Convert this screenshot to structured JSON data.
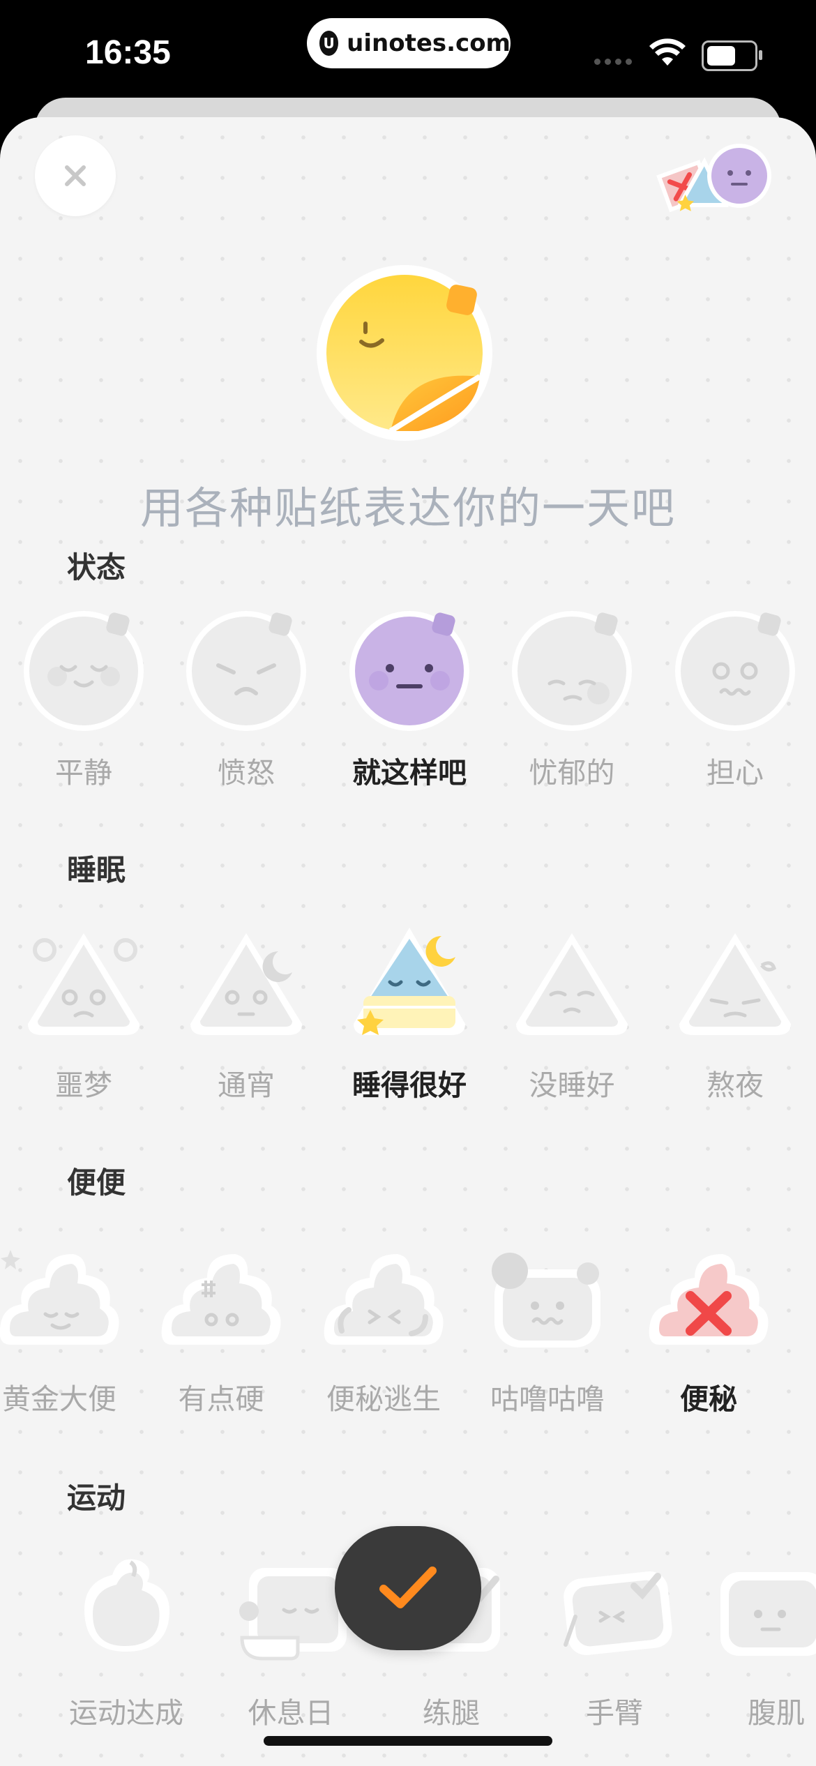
{
  "status_bar": {
    "time": "16:35",
    "url": "uinotes.com",
    "url_logo": "U"
  },
  "header": {
    "close_icon": "close-icon",
    "sticker_stack_icon": "sticker-stack-icon"
  },
  "hero_sticker": "smiley-sticker-icon",
  "subtitle": "用各种贴纸表达你的一天吧",
  "sections": [
    {
      "title": "状态",
      "items": [
        {
          "label": "平静",
          "selected": false
        },
        {
          "label": "愤怒",
          "selected": false
        },
        {
          "label": "就这样吧",
          "selected": true
        },
        {
          "label": "忧郁的",
          "selected": false
        },
        {
          "label": "担心",
          "selected": false
        }
      ]
    },
    {
      "title": "睡眠",
      "items": [
        {
          "label": "噩梦",
          "selected": false
        },
        {
          "label": "通宵",
          "selected": false
        },
        {
          "label": "睡得很好",
          "selected": true
        },
        {
          "label": "没睡好",
          "selected": false
        },
        {
          "label": "熬夜",
          "selected": false
        }
      ]
    },
    {
      "title": "便便",
      "items": [
        {
          "label": "黄金大便",
          "selected": false
        },
        {
          "label": "有点硬",
          "selected": false
        },
        {
          "label": "便秘逃生",
          "selected": false
        },
        {
          "label": "咕噜咕噜",
          "selected": false
        },
        {
          "label": "便秘",
          "selected": true
        }
      ]
    },
    {
      "title": "运动",
      "items": [
        {
          "label": "运动达成",
          "selected": false
        },
        {
          "label": "休息日",
          "selected": false
        },
        {
          "label": "练腿",
          "selected": false
        },
        {
          "label": "手臂",
          "selected": false
        },
        {
          "label": "腹肌",
          "selected": false
        }
      ]
    }
  ],
  "confirm_icon": "checkmark-icon",
  "colors": {
    "selected_mood": "#c9b3e6",
    "selected_sleep": "#a8d4ea",
    "selected_poop": "#f6c9c9",
    "confirm_check": "#ff8a1e",
    "hero_yellow": "#ffd23f"
  }
}
